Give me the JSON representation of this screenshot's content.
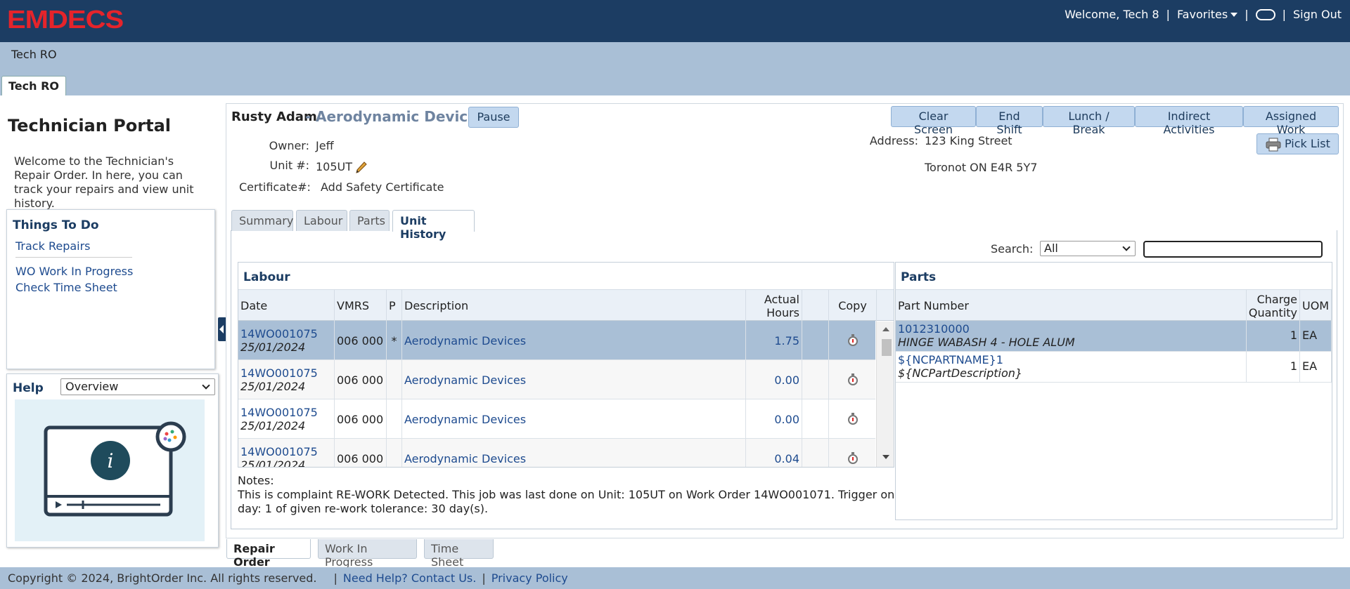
{
  "header": {
    "logo_text": "EMDECS",
    "welcome": "Welcome, Tech 8",
    "favorites": "Favorites",
    "sign_out": "Sign Out"
  },
  "subheader": {
    "title": "Tech RO",
    "tab": "Tech RO"
  },
  "sidebar": {
    "title": "Technician Portal",
    "intro": "Welcome to the Technician's Repair Order. In here, you can track your repairs and view unit history.",
    "things_to_do": {
      "title": "Things To Do",
      "items": [
        "Track Repairs",
        "WO Work In Progress",
        "Check Time Sheet"
      ]
    },
    "help": {
      "title": "Help",
      "selected": "Overview"
    }
  },
  "repair_order": {
    "tech_name": "Rusty Adam",
    "dash": "-",
    "description": "Aerodynamic Devices",
    "pause_label": "Pause",
    "owner_label": "Owner:",
    "owner": "Jeff",
    "unit_label": "Unit #:",
    "unit": "105UT",
    "cert_label": "Certificate#:",
    "cert_link": "Add Safety Certificate",
    "address_label": "Address:",
    "address_line1": "123 King Street",
    "address_line2": "Toronot ON E4R 5Y7",
    "actions": [
      "Clear Screen",
      "End Shift",
      "Lunch / Break",
      "Indirect Activities",
      "Assigned Work"
    ],
    "pick_list": "Pick List"
  },
  "tabs": [
    "Summary",
    "Labour",
    "Parts",
    "Unit History"
  ],
  "search": {
    "label": "Search:",
    "selected": "All",
    "value": ""
  },
  "labour": {
    "title": "Labour",
    "columns": [
      "Date",
      "VMRS",
      "P",
      "Description",
      "Actual Hours",
      "Copy"
    ],
    "rows": [
      {
        "wo": "14WO001075",
        "date": "25/01/2024",
        "vmrs": "006 000",
        "p": "*",
        "desc": "Aerodynamic Devices",
        "hours": "1.75"
      },
      {
        "wo": "14WO001075",
        "date": "25/01/2024",
        "vmrs": "006 000",
        "p": "",
        "desc": "Aerodynamic Devices",
        "hours": "0.00"
      },
      {
        "wo": "14WO001075",
        "date": "25/01/2024",
        "vmrs": "006 000",
        "p": "",
        "desc": "Aerodynamic Devices",
        "hours": "0.00"
      },
      {
        "wo": "14WO001075",
        "date": "25/01/2024",
        "vmrs": "006 000",
        "p": "",
        "desc": "Aerodynamic Devices",
        "hours": "0.04"
      }
    ]
  },
  "parts": {
    "title": "Parts",
    "columns": [
      "Part Number",
      "Charge Quantity",
      "UOM"
    ],
    "rows": [
      {
        "part": "1012310000",
        "desc": "HINGE WABASH 4 - HOLE ALUM",
        "qty": "1",
        "uom": "EA"
      },
      {
        "part": "${NCPARTNAME}1",
        "desc": "${NCPartDescription}",
        "qty": "1",
        "uom": "EA"
      }
    ]
  },
  "notes": {
    "label": "Notes:",
    "text": "This is complaint RE-WORK Detected. This job was last done on Unit: 105UT on Work Order 14WO001071. Trigger on day: 1 of given re-work tolerance: 30 day(s)."
  },
  "bottom_tabs": [
    "Repair Order",
    "Work In Progress",
    "Time Sheet"
  ],
  "footer": {
    "copyright": "Copyright © 2024, BrightOrder Inc. All rights reserved.",
    "help": "Need Help? Contact Us.",
    "privacy": "Privacy Policy"
  },
  "colors": {
    "topbar": "#1c3d63",
    "logo": "#e5242b",
    "subheader": "#a9bfd6",
    "selected_row": "#a9bfd6",
    "link": "#1e4b8f"
  }
}
